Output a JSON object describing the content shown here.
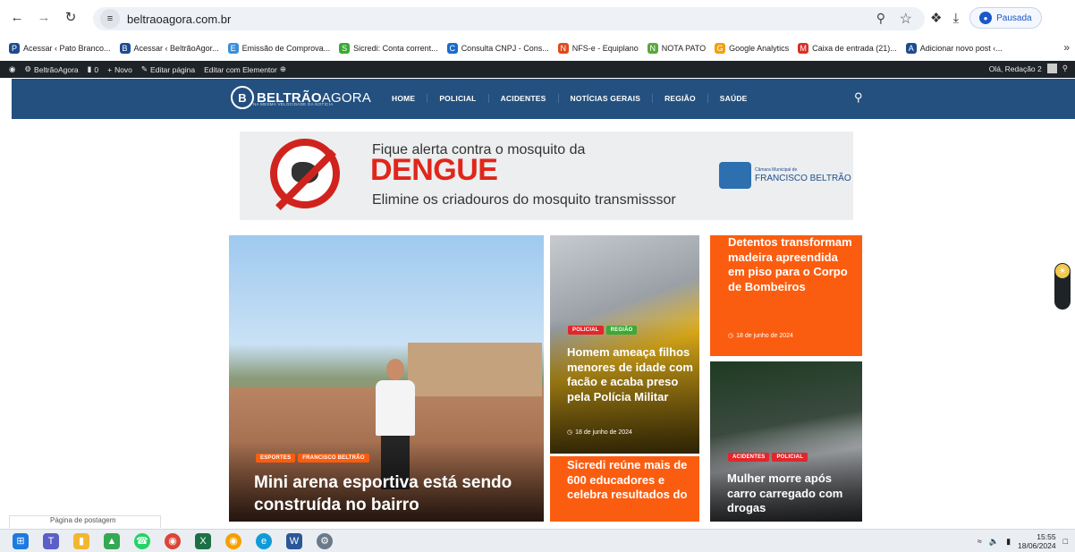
{
  "browser": {
    "url": "beltraoagora.com.br",
    "profile_status": "Pausada",
    "bookmarks": [
      {
        "label": "Acessar ‹ Pato Branco...",
        "color": "#1d4b8f",
        "icon": "P"
      },
      {
        "label": "Acessar ‹ BeltrãoAgor...",
        "color": "#1d4b8f",
        "icon": "B"
      },
      {
        "label": "Emissão de Comprova...",
        "color": "#3b8fd9",
        "icon": "E"
      },
      {
        "label": "Sicredi: Conta corrent...",
        "color": "#3aa935",
        "icon": "S"
      },
      {
        "label": "Consulta CNPJ - Cons...",
        "color": "#1b6ac9",
        "icon": "C"
      },
      {
        "label": "NFS-e - Equiplano",
        "color": "#e04a1b",
        "icon": "N"
      },
      {
        "label": "NOTA PATO",
        "color": "#58a83a",
        "icon": "N"
      },
      {
        "label": "Google Analytics",
        "color": "#f2a00c",
        "icon": "G"
      },
      {
        "label": "Caixa de entrada (21)...",
        "color": "#d93025",
        "icon": "M"
      },
      {
        "label": "Adicionar novo post ‹...",
        "color": "#1d4b8f",
        "icon": "A"
      }
    ]
  },
  "wp_admin": {
    "site_name": "BeltrãoAgora",
    "comments_count": "0",
    "new_label": "Novo",
    "edit_page_label": "Editar página",
    "elementor_label": "Editar com Elementor",
    "greeting": "Olá, Redação 2"
  },
  "site": {
    "logo_bold": "BELTRÃO",
    "logo_light": "AGORA",
    "logo_tagline": "NA MESMA VELOCIDADE DA NOTÍCIA",
    "nav": [
      "HOME",
      "POLICIAL",
      "ACIDENTES",
      "NOTÍCIAS GERAIS",
      "REGIÃO",
      "SAÚDE"
    ]
  },
  "ad": {
    "line1": "Fique alerta contra o mosquito da",
    "line2": "DENGUE",
    "line3": "Elimine os criadouros do mosquito transmisssor",
    "org_small": "Câmara Municipal de",
    "org": "FRANCISCO BELTRÃO"
  },
  "articles": {
    "main": {
      "tags": [
        {
          "label": "ESPORTES",
          "color": "#fb5d10"
        },
        {
          "label": "FRANCISCO BELTRÃO",
          "color": "#fb5d10"
        }
      ],
      "title": "Mini arena esportiva está sendo construída no bairro"
    },
    "yellow": {
      "tags": [
        {
          "label": "POLICIAL",
          "color": "#e2262b"
        },
        {
          "label": "REGIÃO",
          "color": "#3aa935"
        }
      ],
      "title": "Homem ameaça filhos menores de idade com facão e acaba preso pela Polícia Militar",
      "date": "18 de junho de 2024"
    },
    "orange1": {
      "title": "Detentos transformam madeira apreendida em piso para o Corpo de Bombeiros",
      "date": "18 de junho de 2024"
    },
    "orange2": {
      "title": "Sicredi reúne mais de 600 educadores e celebra resultados do"
    },
    "crash": {
      "tags": [
        {
          "label": "ACIDENTES",
          "color": "#e2262b"
        },
        {
          "label": "POLICIAL",
          "color": "#e2262b"
        }
      ],
      "title": "Mulher morre após carro carregado com drogas"
    }
  },
  "status_peek": "Página de postagem",
  "taskbar": {
    "time": "15:55",
    "date": "18/06/2024"
  }
}
